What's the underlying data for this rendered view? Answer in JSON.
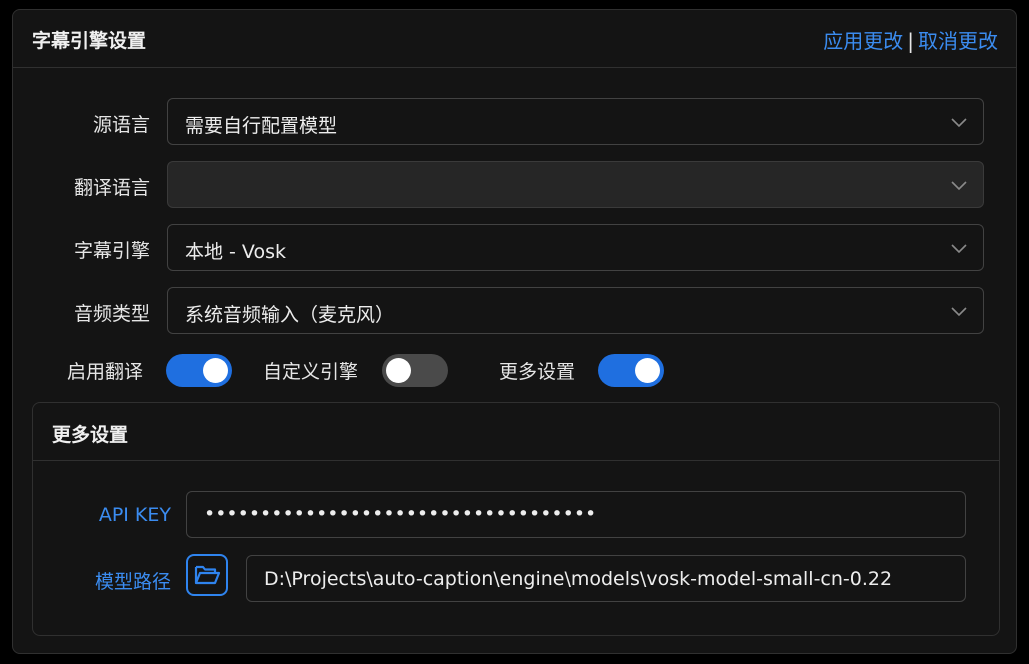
{
  "panel": {
    "title": "字幕引擎设置",
    "apply_label": "应用更改",
    "separator": "|",
    "cancel_label": "取消更改"
  },
  "fields": {
    "source_language": {
      "label": "源语言",
      "value": "需要自行配置模型"
    },
    "target_language": {
      "label": "翻译语言",
      "value": ""
    },
    "caption_engine": {
      "label": "字幕引擎",
      "value": "本地 - Vosk"
    },
    "audio_type": {
      "label": "音频类型",
      "value": "系统音频输入（麦克风）"
    }
  },
  "toggles": {
    "enable_translation": {
      "label": "启用翻译",
      "on": true
    },
    "custom_engine": {
      "label": "自定义引擎",
      "on": false
    },
    "more_settings": {
      "label": "更多设置",
      "on": true
    }
  },
  "more_settings": {
    "title": "更多设置",
    "api_key_label": "API KEY",
    "api_key_value": "•••••••••••••••••••••••••••••••••••",
    "model_path_label": "模型路径",
    "model_path_value": "D:\\Projects\\auto-caption\\engine\\models\\vosk-model-small-cn-0.22"
  },
  "colors": {
    "accent": "#1f6fe0",
    "link": "#3b8cf0",
    "background": "#141414"
  },
  "icons": [
    "chevron-down-icon",
    "folder-open-icon"
  ]
}
